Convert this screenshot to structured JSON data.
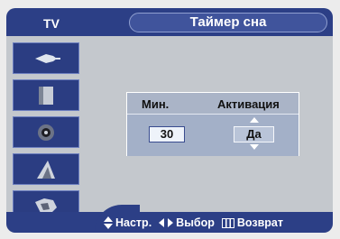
{
  "header": {
    "tv_label": "TV",
    "title": "Таймер сна"
  },
  "sidebar": {
    "items": [
      {
        "icon": "input-icon"
      },
      {
        "icon": "picture-icon"
      },
      {
        "icon": "sound-icon"
      },
      {
        "icon": "channel-icon"
      },
      {
        "icon": "setup-icon"
      }
    ]
  },
  "sleep_timer": {
    "min_label": "Мин.",
    "activation_label": "Активация",
    "min_value": "30",
    "activation_value": "Да"
  },
  "footer": {
    "adjust_label": "Настр.",
    "select_label": "Выбор",
    "return_label": "Возврат"
  },
  "colors": {
    "bar_blue": "#2c3f86",
    "panel_bg": "#aab4c7",
    "osd_bg": "#c4c8cd"
  }
}
